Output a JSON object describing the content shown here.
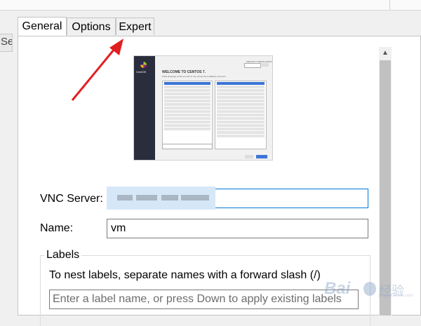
{
  "window": {
    "left_clip_text": "Se"
  },
  "tabs": [
    {
      "label": "General",
      "active": true
    },
    {
      "label": "Options",
      "active": false
    },
    {
      "label": "Expert",
      "active": false
    }
  ],
  "preview": {
    "logo_text": "CentOS",
    "heading": "WELCOME TO CENTOS 7.",
    "subtitle": "What language would you like to use during the installation process?",
    "installation_label": "CENTOS 7 INSTALLATION"
  },
  "form": {
    "vnc_label": "VNC Server:",
    "vnc_value": "",
    "name_label": "Name:",
    "name_value": "vm"
  },
  "labels_group": {
    "title": "Labels",
    "hint": "To nest labels, separate names with a forward slash (/)",
    "placeholder": "Enter a label name, or press Down to apply existing labels"
  },
  "watermark": {
    "brand": "Bai",
    "site": "经验",
    "url": "jingyan.baidu.com"
  },
  "colors": {
    "arrow": "#e02020",
    "focus_border": "#0078d7",
    "selection": "#3b74d6"
  },
  "icons": {
    "scroll_up": "scroll-up-arrow-icon",
    "annotation": "red-arrow-icon"
  }
}
